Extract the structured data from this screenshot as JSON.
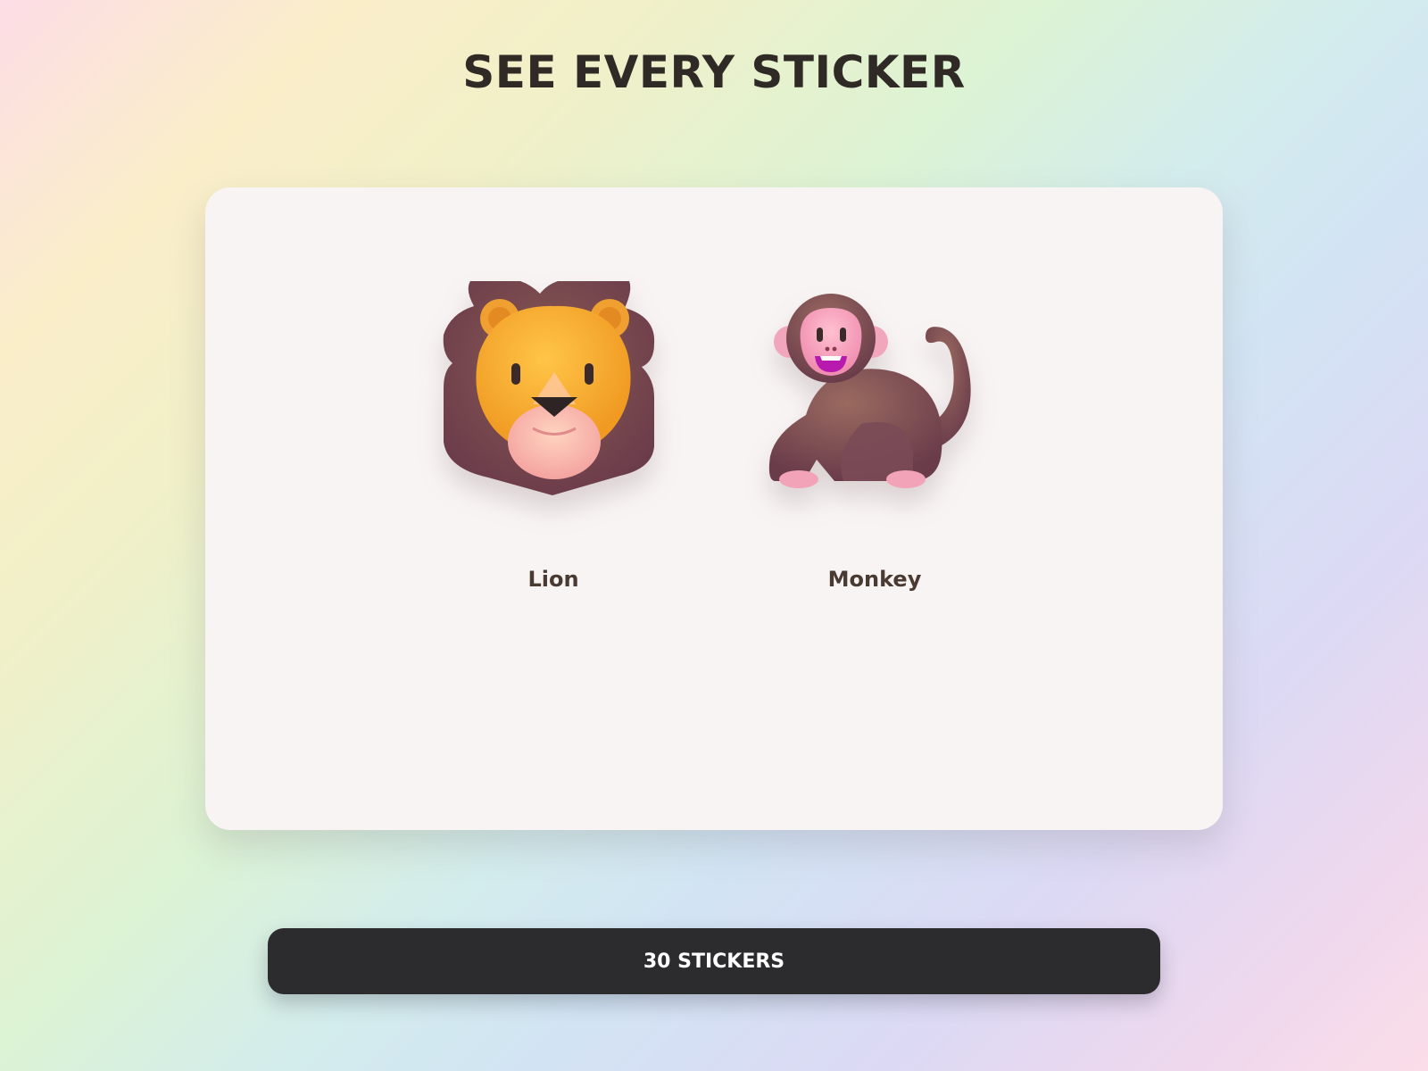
{
  "page": {
    "title": "SEE EVERY STICKER"
  },
  "stickers": [
    {
      "label": "Lion",
      "icon": "lion-icon"
    },
    {
      "label": "Monkey",
      "icon": "monkey-icon"
    }
  ],
  "footer": {
    "count_button_label": "30 STICKERS"
  },
  "colors": {
    "title": "#302a26",
    "card_background": "#f9f4f4",
    "label": "#4a3b32",
    "button_background": "#2c2b2e",
    "button_text": "#ffffff"
  }
}
